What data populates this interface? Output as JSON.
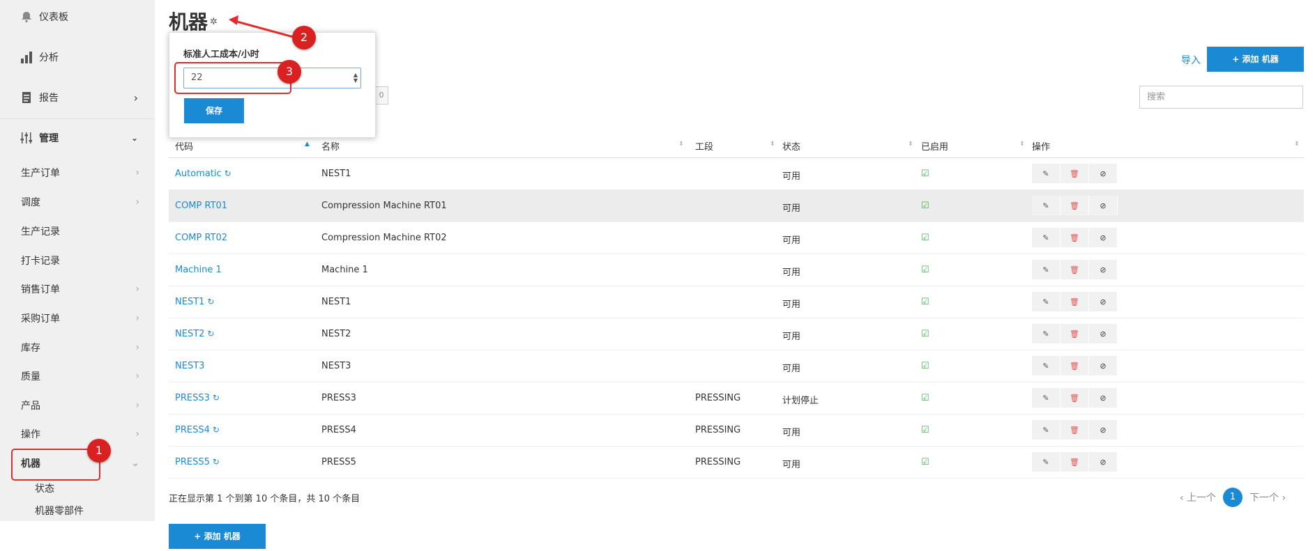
{
  "sidebar": {
    "top": [
      {
        "label": "仪表板",
        "icon": "bell-icon"
      },
      {
        "label": "分析",
        "icon": "bar-chart-icon"
      },
      {
        "label": "报告",
        "icon": "report-icon"
      },
      {
        "label": "管理",
        "icon": "sliders-icon"
      }
    ],
    "items": [
      {
        "label": "生产订单"
      },
      {
        "label": "调度"
      },
      {
        "label": "生产记录"
      },
      {
        "label": "打卡记录"
      },
      {
        "label": "销售订单"
      },
      {
        "label": "采购订单"
      },
      {
        "label": "库存"
      },
      {
        "label": "质量"
      },
      {
        "label": "产品"
      },
      {
        "label": "操作"
      },
      {
        "label": "机器"
      }
    ],
    "sub_items": [
      {
        "label": "状态"
      },
      {
        "label": "机器零部件"
      }
    ]
  },
  "header": {
    "title": "机器"
  },
  "popover": {
    "label": "标准人工成本/小时",
    "value": "22",
    "save_label": "保存"
  },
  "toolbar": {
    "import_label": "导入",
    "add_label": "+ 添加 机器",
    "search_placeholder": "搜索",
    "hint": "0"
  },
  "table": {
    "columns": [
      "代码",
      "名称",
      "工段",
      "状态",
      "已启用",
      "操作"
    ],
    "rows": [
      {
        "code": "Automatic",
        "refresh": true,
        "name": "NEST1",
        "stage": "",
        "status": "可用"
      },
      {
        "code": "COMP RT01",
        "refresh": false,
        "name": "Compression Machine RT01",
        "stage": "",
        "status": "可用"
      },
      {
        "code": "COMP RT02",
        "refresh": false,
        "name": "Compression Machine RT02",
        "stage": "",
        "status": "可用"
      },
      {
        "code": "Machine 1",
        "refresh": false,
        "name": "Machine 1",
        "stage": "",
        "status": "可用"
      },
      {
        "code": "NEST1",
        "refresh": true,
        "name": "NEST1",
        "stage": "",
        "status": "可用"
      },
      {
        "code": "NEST2",
        "refresh": true,
        "name": "NEST2",
        "stage": "",
        "status": "可用"
      },
      {
        "code": "NEST3",
        "refresh": false,
        "name": "NEST3",
        "stage": "",
        "status": "可用"
      },
      {
        "code": "PRESS3",
        "refresh": true,
        "name": "PRESS3",
        "stage": "PRESSING",
        "status": "计划停止"
      },
      {
        "code": "PRESS4",
        "refresh": true,
        "name": "PRESS4",
        "stage": "PRESSING",
        "status": "可用"
      },
      {
        "code": "PRESS5",
        "refresh": true,
        "name": "PRESS5",
        "stage": "PRESSING",
        "status": "可用"
      }
    ]
  },
  "footer": {
    "info": "正在显示第 1 个到第 10 个条目，共 10 个条目",
    "prev": "‹ 上一个",
    "page": "1",
    "next": "下一个 ›",
    "add_label": "+ 添加 机器"
  },
  "annotations": [
    "1",
    "2",
    "3"
  ],
  "colors": {
    "accent": "#1a8ad4",
    "annotation": "#d92121",
    "enabled": "#4caf50",
    "delete": "#e25555"
  }
}
